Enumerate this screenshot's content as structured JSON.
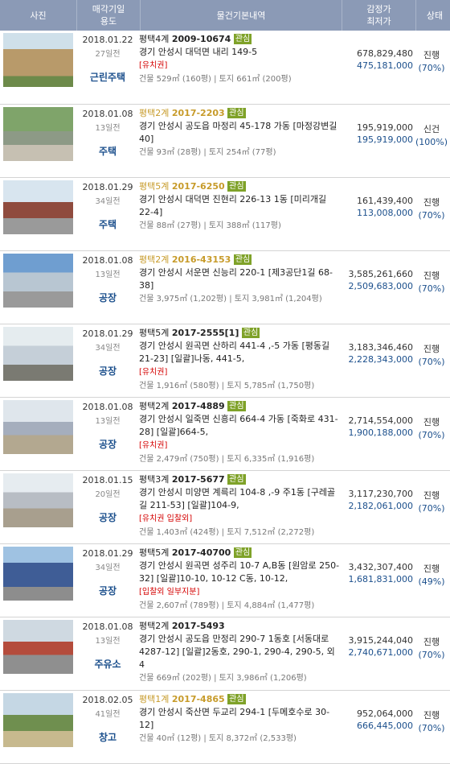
{
  "header": {
    "photo": "사진",
    "date_usage_1": "매각기일",
    "date_usage_2": "용도",
    "details": "물건기본내역",
    "price_1": "감정가",
    "price_2": "최저가",
    "status": "상태"
  },
  "rows": [
    {
      "date": "2018.01.22",
      "ago": "27일전",
      "usage": "근린주택",
      "court": "평택4계",
      "case": "2009-10674",
      "badge": "관심",
      "address": "경기 안성시 대덕면 내리 149-5",
      "warn": "[유치권]",
      "area": "건물 529㎡ (160평) | 토지 661㎡ (200평)",
      "appraisal": "678,829,480",
      "minimum": "475,181,000",
      "status": "진행",
      "pct": "(70%)"
    },
    {
      "date": "2018.01.08",
      "ago": "13일전",
      "usage": "주택",
      "court": "평택2계",
      "case": "2017-2203",
      "badge": "관심",
      "address": "경기 안성시 공도읍 마정리 45-178 가동 [마정강변길 40]",
      "warn": "",
      "area": "건물 93㎡ (28평) | 토지 254㎡ (77평)",
      "appraisal": "195,919,000",
      "minimum": "195,919,000",
      "status": "신건",
      "pct": "(100%)"
    },
    {
      "date": "2018.01.29",
      "ago": "34일전",
      "usage": "주택",
      "court": "평택5계",
      "case": "2017-6250",
      "badge": "관심",
      "address": "경기 안성시 대덕면 진현리 226-13 1동 [미리개길 22-4]",
      "warn": "",
      "area": "건물 88㎡ (27평) | 토지 388㎡ (117평)",
      "appraisal": "161,439,400",
      "minimum": "113,008,000",
      "status": "진행",
      "pct": "(70%)"
    },
    {
      "date": "2018.01.08",
      "ago": "13일전",
      "usage": "공장",
      "court": "평택2계",
      "case": "2016-43153",
      "badge": "관심",
      "address": "경기 안성시 서운면 신능리 220-1 [제3공단1길 68-38]",
      "warn": "",
      "area": "건물 3,975㎡ (1,202평) | 토지 3,981㎡ (1,204평)",
      "appraisal": "3,585,261,660",
      "minimum": "2,509,683,000",
      "status": "진행",
      "pct": "(70%)"
    },
    {
      "date": "2018.01.29",
      "ago": "34일전",
      "usage": "공장",
      "court": "평택5계",
      "case": "2017-2555[1]",
      "badge": "관심",
      "address": "경기 안성시 원곡면 산하리 441-4 ,-5 가동 [평동길 21-23] [일괄]나동, 441-5,",
      "warn": "[유치권]",
      "area": "건물 1,916㎡ (580평) | 토지 5,785㎡ (1,750평)",
      "appraisal": "3,183,346,460",
      "minimum": "2,228,343,000",
      "status": "진행",
      "pct": "(70%)"
    },
    {
      "date": "2018.01.08",
      "ago": "13일전",
      "usage": "공장",
      "court": "평택2계",
      "case": "2017-4889",
      "badge": "관심",
      "address": "경기 안성시 일죽면 신흥리 664-4 가동 [죽화로 431-28] [일괄]664-5,",
      "warn": "[유치권]",
      "area": "건물 2,479㎡ (750평) | 토지 6,335㎡ (1,916평)",
      "appraisal": "2,714,554,000",
      "minimum": "1,900,188,000",
      "status": "진행",
      "pct": "(70%)"
    },
    {
      "date": "2018.01.15",
      "ago": "20일전",
      "usage": "공장",
      "court": "평택3계",
      "case": "2017-5677",
      "badge": "관심",
      "address": "경기 안성시 미양면 계륵리 104-8 ,-9 주1동 [구레골길 211-53] [일괄]104-9,",
      "warn": "[유치권 입찰외]",
      "area": "건물 1,403㎡ (424평) | 토지 7,512㎡ (2,272평)",
      "appraisal": "3,117,230,700",
      "minimum": "2,182,061,000",
      "status": "진행",
      "pct": "(70%)"
    },
    {
      "date": "2018.01.29",
      "ago": "34일전",
      "usage": "공장",
      "court": "평택5계",
      "case": "2017-40700",
      "badge": "관심",
      "address": "경기 안성시 원곡면 성주리 10-7 A,B동 [원암로 250-32] [일괄]10-10, 10-12 C동, 10-12,",
      "warn": "[입찰외 일부지분]",
      "area": "건물 2,607㎡ (789평) | 토지 4,884㎡ (1,477평)",
      "appraisal": "3,432,307,400",
      "minimum": "1,681,831,000",
      "status": "진행",
      "pct": "(49%)"
    },
    {
      "date": "2018.01.08",
      "ago": "13일전",
      "usage": "주유소",
      "court": "평택2계",
      "case": "2017-5493",
      "badge": "",
      "address": "경기 안성시 공도읍 만정리 290-7 1동호 [서동대로 4287-12] [일괄]2동호, 290-1, 290-4, 290-5, 외4",
      "warn": "",
      "area": "건물 669㎡ (202평) | 토지 3,986㎡ (1,206평)",
      "appraisal": "3,915,244,040",
      "minimum": "2,740,671,000",
      "status": "진행",
      "pct": "(70%)"
    },
    {
      "date": "2018.02.05",
      "ago": "41일전",
      "usage": "창고",
      "court": "평택1계",
      "case": "2017-4865",
      "badge": "관심",
      "address": "경기 안성시 죽산면 두교리 294-1 [두메호수로 30-12]",
      "warn": "",
      "area": "건물 40㎡ (12평) | 토지 8,372㎡ (2,533평)",
      "appraisal": "952,064,000",
      "minimum": "666,445,000",
      "status": "진행",
      "pct": "(70%)"
    }
  ]
}
